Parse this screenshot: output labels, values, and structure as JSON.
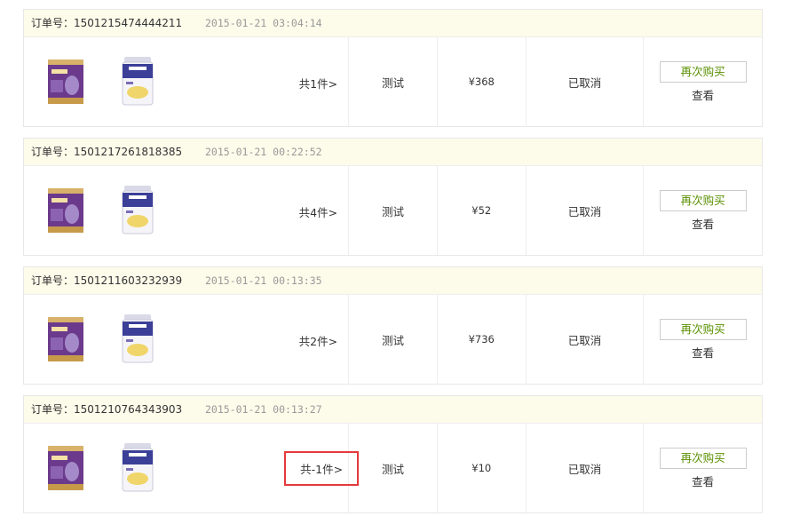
{
  "labels": {
    "order_no": "订单号：",
    "rebuy": "再次购买",
    "view": "查看"
  },
  "orders": [
    {
      "number": "1501215474444211",
      "time": "2015-01-21 03:04:14",
      "qty": "共1件>",
      "name": "测试",
      "price": "¥368",
      "status": "已取消",
      "highlight": false
    },
    {
      "number": "1501217261818385",
      "time": "2015-01-21 00:22:52",
      "qty": "共4件>",
      "name": "测试",
      "price": "¥52",
      "status": "已取消",
      "highlight": false
    },
    {
      "number": "1501211603232939",
      "time": "2015-01-21 00:13:35",
      "qty": "共2件>",
      "name": "测试",
      "price": "¥736",
      "status": "已取消",
      "highlight": false
    },
    {
      "number": "1501210764343903",
      "time": "2015-01-21 00:13:27",
      "qty": "共-1件>",
      "name": "测试",
      "price": "¥10",
      "status": "已取消",
      "highlight": true
    }
  ],
  "colors": {
    "header_bg": "#fdfbea",
    "rebuy_text": "#5a8f00",
    "highlight_border": "#e4393c"
  },
  "icons": [
    "milk-powder-box-icon",
    "milk-powder-can-icon"
  ]
}
